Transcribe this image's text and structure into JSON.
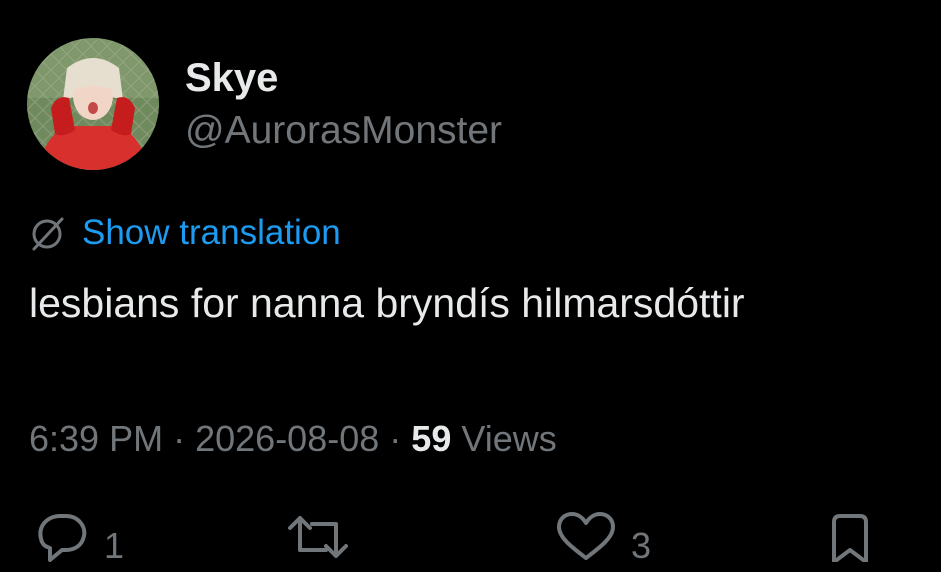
{
  "user": {
    "display_name": "Skye",
    "handle": "@AurorasMonster"
  },
  "translation": {
    "icon": "globe-slash-icon",
    "label": "Show translation"
  },
  "tweet": {
    "text": "lesbians for nanna bryndís hilmarsdóttir"
  },
  "meta": {
    "time": "6:39 PM",
    "separator": "·",
    "date": "2026-08-08",
    "views_count": "59",
    "views_label": "Views"
  },
  "actions": {
    "reply_count": "1",
    "repost_count": "",
    "like_count": "3"
  },
  "colors": {
    "background": "#000000",
    "text": "#e7e9ea",
    "secondary": "#71767b",
    "link": "#1d9bf0"
  }
}
